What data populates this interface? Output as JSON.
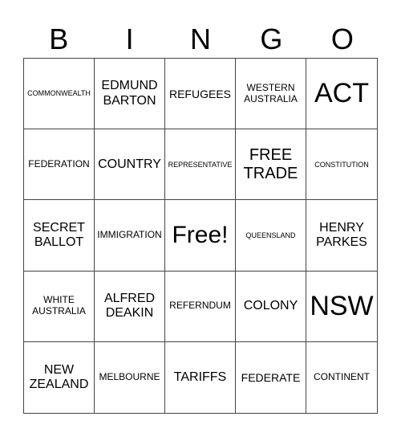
{
  "header": [
    "B",
    "I",
    "N",
    "G",
    "O"
  ],
  "cells": [
    {
      "text": "COMMONWEALTH",
      "size": "s-xs"
    },
    {
      "text": "EDMUND BARTON",
      "size": "s-lg"
    },
    {
      "text": "REFUGEES",
      "size": "s-md"
    },
    {
      "text": "WESTERN AUSTRALIA",
      "size": "s-sm"
    },
    {
      "text": "ACT",
      "size": "s-xxl"
    },
    {
      "text": "FEDERATION",
      "size": "s-sm"
    },
    {
      "text": "COUNTRY",
      "size": "s-lg"
    },
    {
      "text": "REPRESENTATIVE",
      "size": "s-xs"
    },
    {
      "text": "FREE TRADE",
      "size": "s-xl"
    },
    {
      "text": "CONSTITUTION",
      "size": "s-xs"
    },
    {
      "text": "SECRET BALLOT",
      "size": "s-lg"
    },
    {
      "text": "IMMIGRATION",
      "size": "s-sm"
    },
    {
      "text": "Free!",
      "size": "s-free"
    },
    {
      "text": "QUEENSLAND",
      "size": "s-xs"
    },
    {
      "text": "HENRY PARKES",
      "size": "s-lg"
    },
    {
      "text": "WHITE AUSTRALIA",
      "size": "s-sm"
    },
    {
      "text": "ALFRED DEAKIN",
      "size": "s-lg"
    },
    {
      "text": "REFERNDUM",
      "size": "s-sm"
    },
    {
      "text": "COLONY",
      "size": "s-lg"
    },
    {
      "text": "NSW",
      "size": "s-xxl"
    },
    {
      "text": "NEW ZEALAND",
      "size": "s-lg"
    },
    {
      "text": "MELBOURNE",
      "size": "s-sm"
    },
    {
      "text": "TARIFFS",
      "size": "s-lg"
    },
    {
      "text": "FEDERATE",
      "size": "s-md"
    },
    {
      "text": "CONTINENT",
      "size": "s-sm"
    }
  ]
}
